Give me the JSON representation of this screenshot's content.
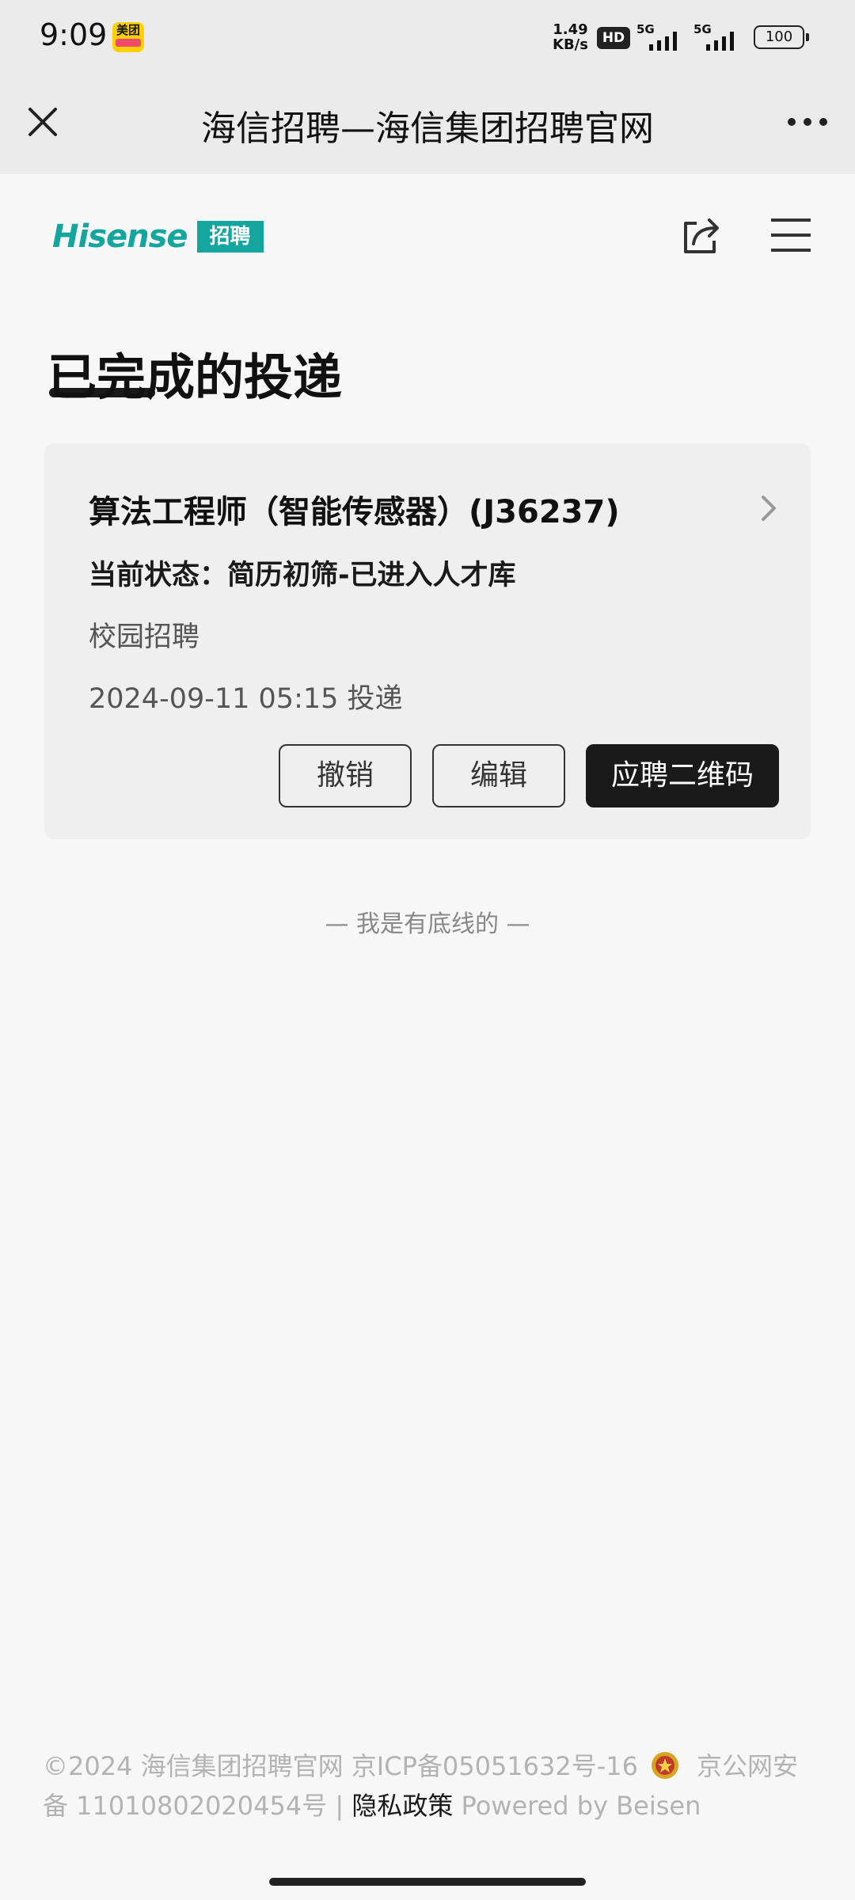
{
  "status_bar": {
    "time": "9:09",
    "app_badge": "美团",
    "net_speed_value": "1.49",
    "net_speed_unit": "KB/s",
    "hd_label": "HD",
    "sim1_label": "5G",
    "sim2_label": "5G",
    "battery": "100"
  },
  "nav": {
    "title": "海信招聘—海信集团招聘官网"
  },
  "header": {
    "logo_text": "Hisense",
    "logo_badge": "招聘"
  },
  "page": {
    "title": "已完成的投递"
  },
  "application": {
    "job_title": "算法工程师（智能传感器）(J36237)",
    "status": "当前状态：简历初筛-已进入人才库",
    "recruit_type": "校园招聘",
    "submitted": "2024-09-11 05:15 投递",
    "withdraw_label": "撤销",
    "edit_label": "编辑",
    "qr_label": "应聘二维码"
  },
  "end_text": "— 我是有底线的 —",
  "footer": {
    "line1_a": "©2024 海信集团招聘官网  京ICP备05051632号-16",
    "line1_b": "京公网安",
    "line2_a": "备 11010802020454号 | ",
    "privacy": "隐私政策",
    "powered": " Powered by Beisen"
  },
  "colors": {
    "brand": "#14a69e",
    "primary_button": "#1a1a1a"
  }
}
